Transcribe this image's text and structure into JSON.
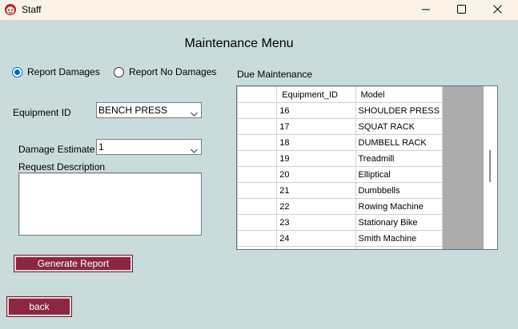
{
  "window": {
    "title": "Staff",
    "app_icon": "cartoon-face-icon",
    "controls": [
      "minimize-icon",
      "maximize-icon",
      "close-icon"
    ]
  },
  "heading": "Maintenance Menu",
  "report_options": {
    "report_damages": "Report Damages",
    "report_no_damages": "Report No Damages",
    "selected": "report_damages"
  },
  "equipment": {
    "label": "Equipment ID",
    "value": "BENCH PRESS"
  },
  "damage_estimate": {
    "label": "Damage Estimate",
    "value": "1"
  },
  "request_description": {
    "label": "Request Description",
    "value": ""
  },
  "buttons": {
    "generate_report": "Generate Report",
    "back": "back"
  },
  "due_maintenance": {
    "label": "Due Maintenance",
    "columns": [
      "Equipment_ID",
      "Model"
    ],
    "rows": [
      [
        "16",
        "SHOULDER PRESS"
      ],
      [
        "17",
        "SQUAT RACK"
      ],
      [
        "18",
        "DUMBELL RACK"
      ],
      [
        "19",
        "Treadmill"
      ],
      [
        "20",
        "Elliptical"
      ],
      [
        "21",
        "Dumbbells"
      ],
      [
        "22",
        "Rowing Machine"
      ],
      [
        "23",
        "Stationary Bike"
      ],
      [
        "24",
        "Smith Machine"
      ],
      [
        "",
        ""
      ]
    ]
  },
  "colors": {
    "form_background": "#c9dbdb",
    "button_background": "#8b2741",
    "titlebar_background": "#fbf3e8",
    "radio_accent": "#0067c0"
  }
}
